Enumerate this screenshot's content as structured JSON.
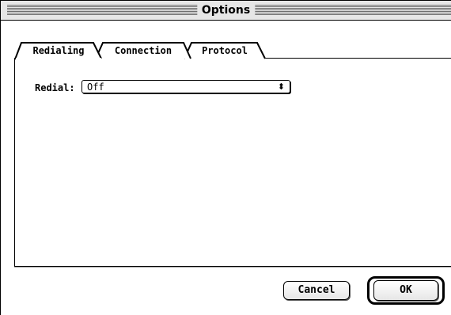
{
  "window": {
    "title": "Options"
  },
  "tabs": [
    {
      "label": "Redialing",
      "selected": true
    },
    {
      "label": "Connection",
      "selected": false
    },
    {
      "label": "Protocol",
      "selected": false
    }
  ],
  "redialing": {
    "redial_label": "Redial:",
    "redial_value": "Off",
    "popup_arrows": "⬍"
  },
  "buttons": {
    "cancel": "Cancel",
    "ok": "OK"
  },
  "colors": {
    "background": "#ffffff",
    "titlebar": "#e6e6e6",
    "stripes": "#6e6e6e",
    "border": "#000000"
  }
}
